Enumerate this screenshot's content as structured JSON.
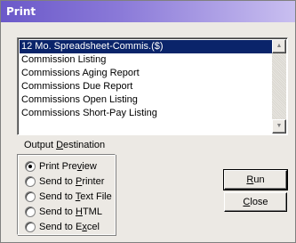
{
  "window": {
    "title": "Print"
  },
  "report_list": {
    "items": [
      "12 Mo. Spreadsheet-Commis.($)",
      "Commission Listing",
      "Commissions Aging Report",
      "Commissions Due Report",
      "Commissions Open Listing",
      "Commissions Short-Pay Listing"
    ],
    "selected_index": 0,
    "scroll_up_icon": "triangle-up-icon",
    "scroll_down_icon": "triangle-down-icon"
  },
  "output_destination": {
    "label_pre": "Output ",
    "label_key": "D",
    "label_post": "estination",
    "selected_index": 0,
    "options": [
      {
        "pre": "Print Pre",
        "key": "v",
        "post": "iew"
      },
      {
        "pre": "Send to ",
        "key": "P",
        "post": "rinter"
      },
      {
        "pre": "Send to ",
        "key": "T",
        "post": "ext File"
      },
      {
        "pre": "Send to ",
        "key": "H",
        "post": "TML"
      },
      {
        "pre": "Send to E",
        "key": "x",
        "post": "cel"
      }
    ]
  },
  "buttons": {
    "run": {
      "key": "R",
      "post": "un"
    },
    "close": {
      "key": "C",
      "post": "lose"
    }
  }
}
